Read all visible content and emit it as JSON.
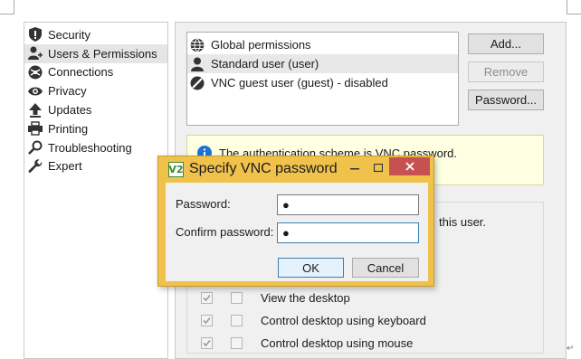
{
  "sidebar": {
    "items": [
      {
        "label": "Security",
        "icon": "shield-icon"
      },
      {
        "label": "Users & Permissions",
        "icon": "users-icon"
      },
      {
        "label": "Connections",
        "icon": "connections-icon"
      },
      {
        "label": "Privacy",
        "icon": "eye-icon"
      },
      {
        "label": "Updates",
        "icon": "upload-arrow-icon"
      },
      {
        "label": "Printing",
        "icon": "printer-icon"
      },
      {
        "label": "Troubleshooting",
        "icon": "magnifier-icon"
      },
      {
        "label": "Expert",
        "icon": "wrench-icon"
      }
    ],
    "selected_index": 1
  },
  "users": {
    "rows": [
      {
        "label": "Global permissions",
        "icon": "globe-icon"
      },
      {
        "label": "Standard user (user)",
        "icon": "user-icon"
      },
      {
        "label": "VNC guest user (guest) - disabled",
        "icon": "disabled-icon"
      }
    ],
    "selected_index": 1
  },
  "buttons": {
    "add": "Add...",
    "remove": "Remove",
    "password": "Password..."
  },
  "info": {
    "text": "The authentication scheme is VNC password."
  },
  "permissions": {
    "partial_text": "this user.",
    "rows": [
      {
        "label": "View the desktop",
        "checked": true
      },
      {
        "label": "Control desktop using keyboard",
        "checked": true
      },
      {
        "label": "Control desktop using mouse",
        "checked": true
      }
    ]
  },
  "dialog": {
    "title": "Specify VNC password",
    "logo_text": "V2",
    "password_label": "Password:",
    "password_value": "●",
    "confirm_label": "Confirm password:",
    "confirm_value": "●",
    "ok": "OK",
    "cancel": "Cancel"
  },
  "colors": {
    "dialog_frame": "#f0c24b",
    "close_button": "#c75050",
    "info_background": "#ffffe1",
    "info_icon": "#1e6fd9"
  },
  "document": {
    "paragraph_mark": "↵"
  }
}
